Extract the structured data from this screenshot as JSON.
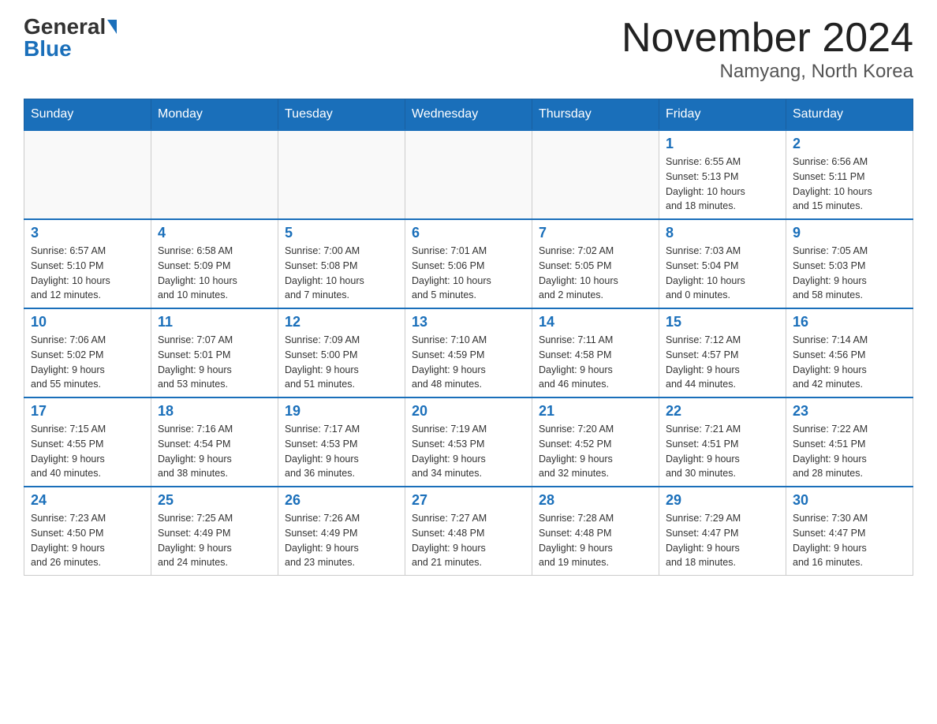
{
  "header": {
    "logo_general": "General",
    "logo_blue": "Blue",
    "month_title": "November 2024",
    "location": "Namyang, North Korea"
  },
  "days_of_week": [
    "Sunday",
    "Monday",
    "Tuesday",
    "Wednesday",
    "Thursday",
    "Friday",
    "Saturday"
  ],
  "weeks": [
    [
      {
        "day": "",
        "info": ""
      },
      {
        "day": "",
        "info": ""
      },
      {
        "day": "",
        "info": ""
      },
      {
        "day": "",
        "info": ""
      },
      {
        "day": "",
        "info": ""
      },
      {
        "day": "1",
        "info": "Sunrise: 6:55 AM\nSunset: 5:13 PM\nDaylight: 10 hours\nand 18 minutes."
      },
      {
        "day": "2",
        "info": "Sunrise: 6:56 AM\nSunset: 5:11 PM\nDaylight: 10 hours\nand 15 minutes."
      }
    ],
    [
      {
        "day": "3",
        "info": "Sunrise: 6:57 AM\nSunset: 5:10 PM\nDaylight: 10 hours\nand 12 minutes."
      },
      {
        "day": "4",
        "info": "Sunrise: 6:58 AM\nSunset: 5:09 PM\nDaylight: 10 hours\nand 10 minutes."
      },
      {
        "day": "5",
        "info": "Sunrise: 7:00 AM\nSunset: 5:08 PM\nDaylight: 10 hours\nand 7 minutes."
      },
      {
        "day": "6",
        "info": "Sunrise: 7:01 AM\nSunset: 5:06 PM\nDaylight: 10 hours\nand 5 minutes."
      },
      {
        "day": "7",
        "info": "Sunrise: 7:02 AM\nSunset: 5:05 PM\nDaylight: 10 hours\nand 2 minutes."
      },
      {
        "day": "8",
        "info": "Sunrise: 7:03 AM\nSunset: 5:04 PM\nDaylight: 10 hours\nand 0 minutes."
      },
      {
        "day": "9",
        "info": "Sunrise: 7:05 AM\nSunset: 5:03 PM\nDaylight: 9 hours\nand 58 minutes."
      }
    ],
    [
      {
        "day": "10",
        "info": "Sunrise: 7:06 AM\nSunset: 5:02 PM\nDaylight: 9 hours\nand 55 minutes."
      },
      {
        "day": "11",
        "info": "Sunrise: 7:07 AM\nSunset: 5:01 PM\nDaylight: 9 hours\nand 53 minutes."
      },
      {
        "day": "12",
        "info": "Sunrise: 7:09 AM\nSunset: 5:00 PM\nDaylight: 9 hours\nand 51 minutes."
      },
      {
        "day": "13",
        "info": "Sunrise: 7:10 AM\nSunset: 4:59 PM\nDaylight: 9 hours\nand 48 minutes."
      },
      {
        "day": "14",
        "info": "Sunrise: 7:11 AM\nSunset: 4:58 PM\nDaylight: 9 hours\nand 46 minutes."
      },
      {
        "day": "15",
        "info": "Sunrise: 7:12 AM\nSunset: 4:57 PM\nDaylight: 9 hours\nand 44 minutes."
      },
      {
        "day": "16",
        "info": "Sunrise: 7:14 AM\nSunset: 4:56 PM\nDaylight: 9 hours\nand 42 minutes."
      }
    ],
    [
      {
        "day": "17",
        "info": "Sunrise: 7:15 AM\nSunset: 4:55 PM\nDaylight: 9 hours\nand 40 minutes."
      },
      {
        "day": "18",
        "info": "Sunrise: 7:16 AM\nSunset: 4:54 PM\nDaylight: 9 hours\nand 38 minutes."
      },
      {
        "day": "19",
        "info": "Sunrise: 7:17 AM\nSunset: 4:53 PM\nDaylight: 9 hours\nand 36 minutes."
      },
      {
        "day": "20",
        "info": "Sunrise: 7:19 AM\nSunset: 4:53 PM\nDaylight: 9 hours\nand 34 minutes."
      },
      {
        "day": "21",
        "info": "Sunrise: 7:20 AM\nSunset: 4:52 PM\nDaylight: 9 hours\nand 32 minutes."
      },
      {
        "day": "22",
        "info": "Sunrise: 7:21 AM\nSunset: 4:51 PM\nDaylight: 9 hours\nand 30 minutes."
      },
      {
        "day": "23",
        "info": "Sunrise: 7:22 AM\nSunset: 4:51 PM\nDaylight: 9 hours\nand 28 minutes."
      }
    ],
    [
      {
        "day": "24",
        "info": "Sunrise: 7:23 AM\nSunset: 4:50 PM\nDaylight: 9 hours\nand 26 minutes."
      },
      {
        "day": "25",
        "info": "Sunrise: 7:25 AM\nSunset: 4:49 PM\nDaylight: 9 hours\nand 24 minutes."
      },
      {
        "day": "26",
        "info": "Sunrise: 7:26 AM\nSunset: 4:49 PM\nDaylight: 9 hours\nand 23 minutes."
      },
      {
        "day": "27",
        "info": "Sunrise: 7:27 AM\nSunset: 4:48 PM\nDaylight: 9 hours\nand 21 minutes."
      },
      {
        "day": "28",
        "info": "Sunrise: 7:28 AM\nSunset: 4:48 PM\nDaylight: 9 hours\nand 19 minutes."
      },
      {
        "day": "29",
        "info": "Sunrise: 7:29 AM\nSunset: 4:47 PM\nDaylight: 9 hours\nand 18 minutes."
      },
      {
        "day": "30",
        "info": "Sunrise: 7:30 AM\nSunset: 4:47 PM\nDaylight: 9 hours\nand 16 minutes."
      }
    ]
  ]
}
